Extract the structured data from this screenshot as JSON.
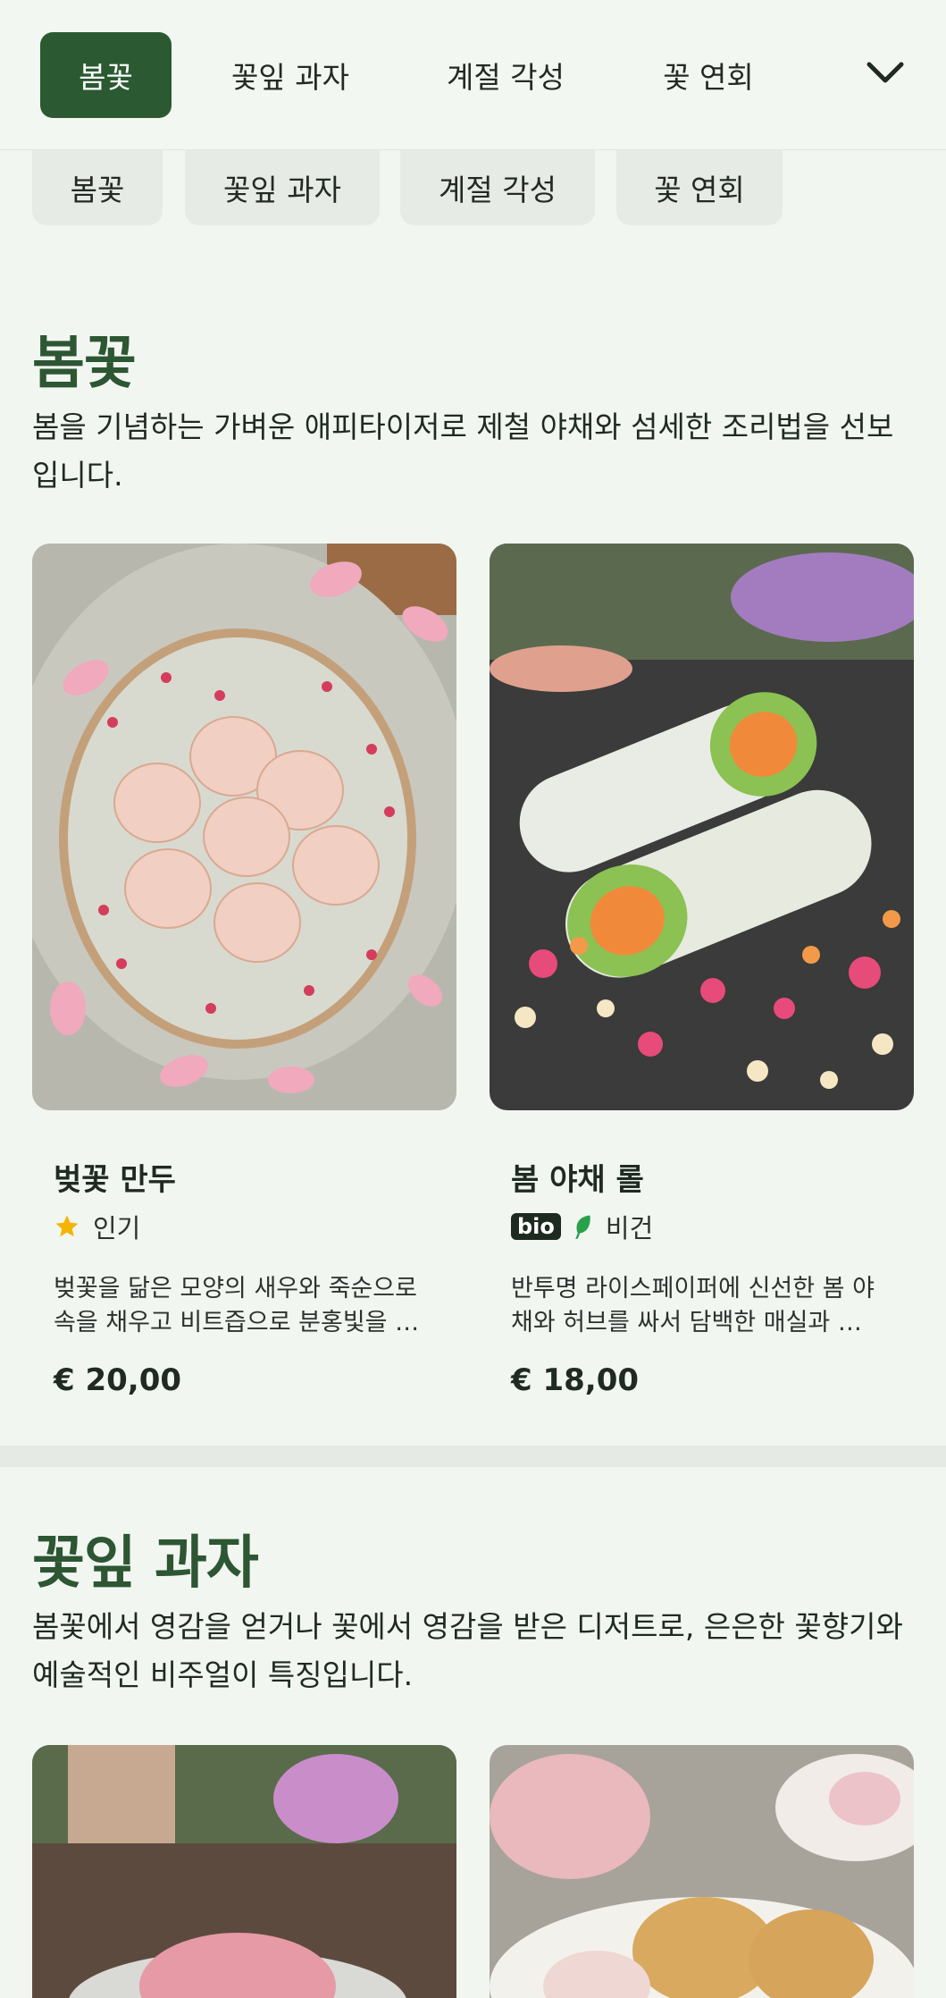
{
  "nav": {
    "tabs": [
      {
        "label": "봄꽃",
        "active": true
      },
      {
        "label": "꽃잎 과자",
        "active": false
      },
      {
        "label": "계절 각성",
        "active": false
      },
      {
        "label": "꽃 연회",
        "active": false
      }
    ],
    "expand_icon": "chevron-down-icon"
  },
  "chips": [
    "봄꽃",
    "꽃잎 과자",
    "계절 각성",
    "꽃 연회"
  ],
  "sections": [
    {
      "title": "봄꽃",
      "description": "봄을 기념하는 가벼운 애피타이저로 제철 야채와 섬세한 조리법을 선보입니다.",
      "items": [
        {
          "name": "벚꽃 만두",
          "tags": [
            {
              "icon": "star-icon",
              "label": "인기"
            }
          ],
          "description": "벚꽃을 닮은 모양의 새우와 죽순으로 속을 채우고 비트즙으로 분홍빛을 …",
          "price": "€ 20,00"
        },
        {
          "name": "봄 야채 롤",
          "tags": [
            {
              "badge": "bio"
            },
            {
              "icon": "leaf-icon",
              "label": "비건"
            }
          ],
          "description": "반투명 라이스페이퍼에 신선한 봄 야채와 허브를 싸서 담백한 매실과 …",
          "price": "€ 18,00"
        }
      ]
    },
    {
      "title": "꽃잎 과자",
      "description": "봄꽃에서 영감을 얻거나 꽃에서 영감을 받은 디저트로, 은은한 꽃향기와 예술적인 비주얼이 특징입니다."
    }
  ],
  "colors": {
    "accent": "#2b5a32",
    "background": "#f2f6f1",
    "star": "#f5b400",
    "leaf": "#27a24a"
  }
}
